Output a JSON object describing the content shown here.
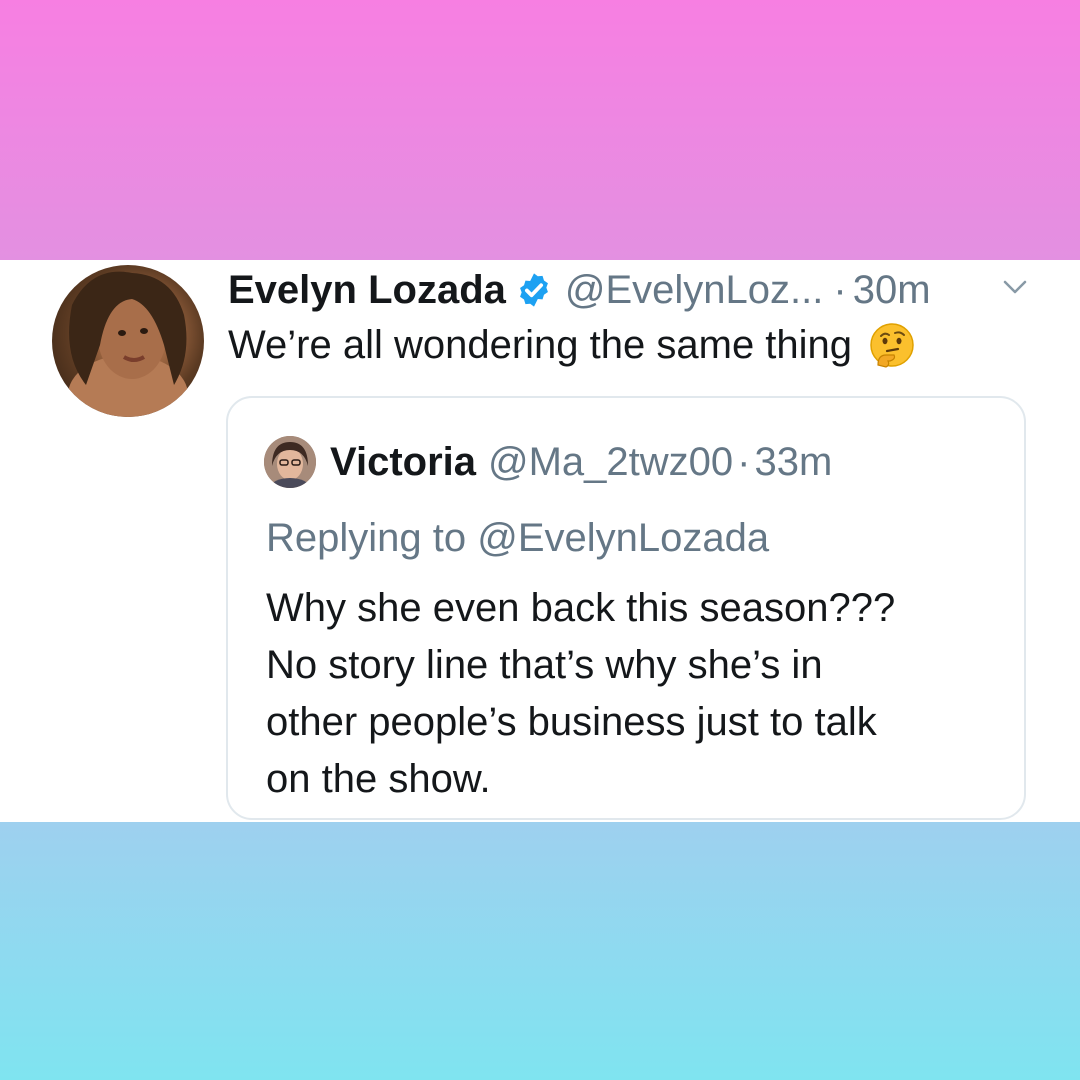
{
  "colors": {
    "top_band": "#f77fe2",
    "bottom_band": "#7fe4f0",
    "verified_blue": "#1da1f2",
    "secondary_text": "#657786"
  },
  "tweet": {
    "author_name": "Evelyn Lozada",
    "verified_icon": "verified-badge-icon",
    "handle": "@EvelynLoz...",
    "separator": "·",
    "time": "30m",
    "menu_icon": "chevron-down-icon",
    "text": "We’re all wondering the same thing",
    "emoji_icon": "thinking-face-emoji",
    "quoted": {
      "author_name": "Victoria",
      "handle": "@Ma_2twz00",
      "separator": "·",
      "time": "33m",
      "replying_prefix": "Replying to ",
      "replying_to": "@EvelynLozada",
      "text_lines": [
        "Why she even back this season???",
        "No story line that’s why she’s in",
        "other people’s business just to talk",
        "on the show."
      ]
    }
  }
}
